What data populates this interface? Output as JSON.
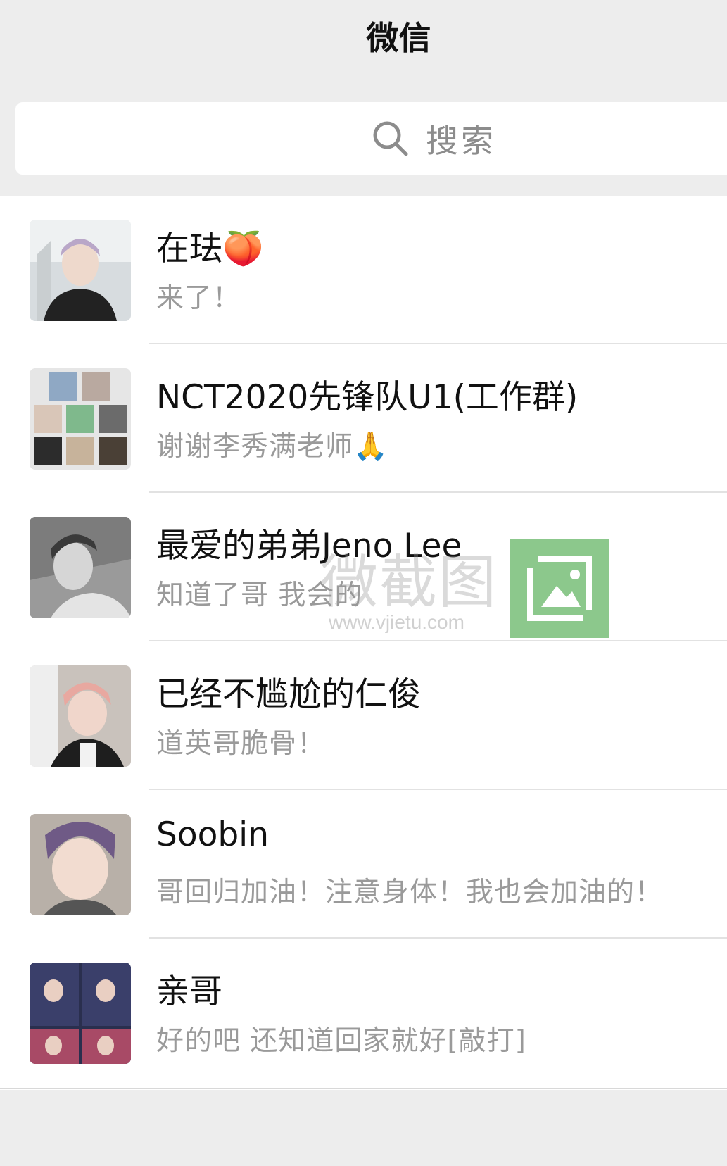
{
  "header": {
    "title": "微信"
  },
  "search": {
    "placeholder": "搜索",
    "icon": "search-icon"
  },
  "chats": [
    {
      "name": "在珐🍑",
      "preview": "来了！",
      "avatar": "avatar-photo"
    },
    {
      "name": "NCT2020先锋队U1(工作群)",
      "preview": "谢谢李秀满老师🙏",
      "avatar": "group-avatar-grid"
    },
    {
      "name": "最爱的弟弟Jeno Lee",
      "preview": "知道了哥 我会的",
      "avatar": "avatar-photo"
    },
    {
      "name": "已经不尴尬的仁俊",
      "preview": "道英哥脆骨！",
      "avatar": "avatar-photo"
    },
    {
      "name": "Soobin",
      "preview": "哥回归加油！注意身体！我也会加油的！",
      "avatar": "avatar-photo"
    },
    {
      "name": "亲哥",
      "preview": "好的吧 还知道回家就好[敲打]",
      "avatar": "avatar-photo"
    }
  ],
  "watermark": {
    "text": "微截图",
    "url": "www.vjietu.com"
  },
  "colors": {
    "background": "#EDEDED",
    "list": "#FFFFFF",
    "preview_text": "#9A9A9A",
    "watermark_green": "#78BE78"
  }
}
